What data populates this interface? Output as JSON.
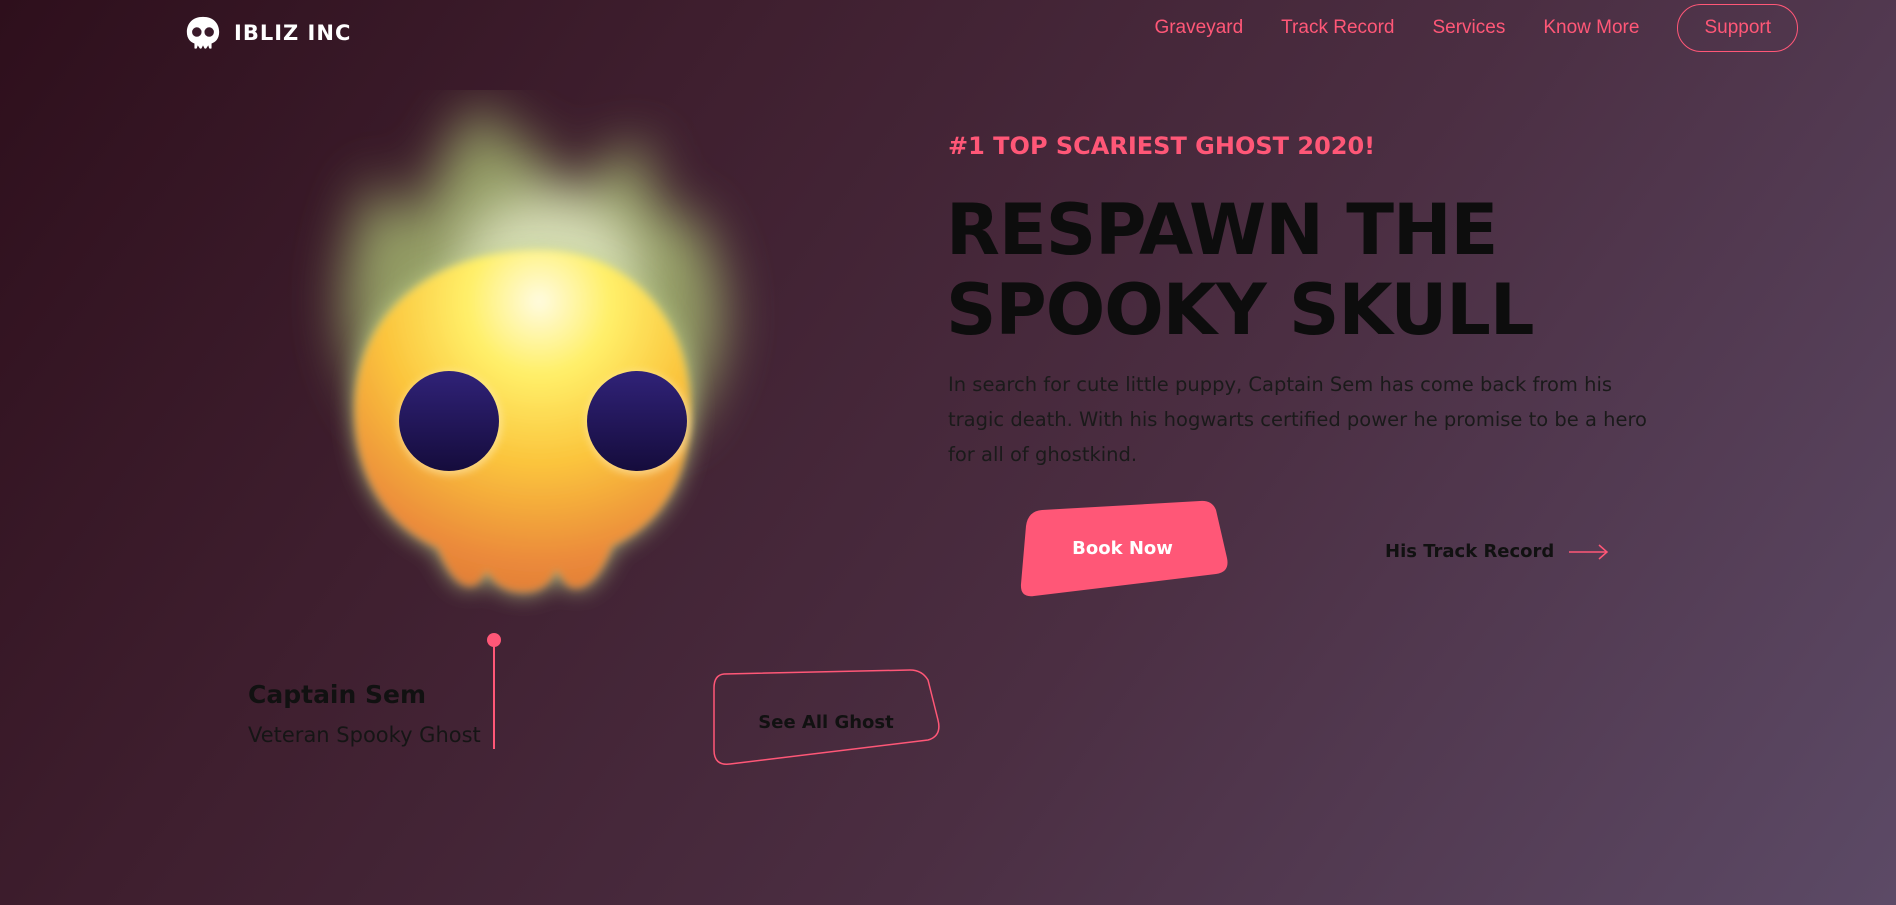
{
  "brand": {
    "name": "IBLIZ INC",
    "icon": "skull-logo-icon"
  },
  "nav": {
    "links": [
      "Graveyard",
      "Track Record",
      "Services",
      "Know More"
    ],
    "support_label": "Support"
  },
  "hero": {
    "tagline": "#1 TOP SCARIEST GHOST 2020!",
    "headline_line1": "RESPAWN THE",
    "headline_line2": "SPOOKY SKULL",
    "description": "In search for cute little puppy, Captain Sem has come back from his tragic death. With his hogwarts certified power he promise to be a hero for all of ghostkind.",
    "book_label": "Book Now",
    "track_label": "His Track Record"
  },
  "character": {
    "name": "Captain Sem",
    "role": "Veteran Spooky Ghost",
    "see_all_label": "See All Ghost"
  },
  "colors": {
    "accent": "#ff5777",
    "background_start": "#2e0f1c",
    "background_end": "#5c4a66",
    "text_dark": "#0d0d0d"
  }
}
